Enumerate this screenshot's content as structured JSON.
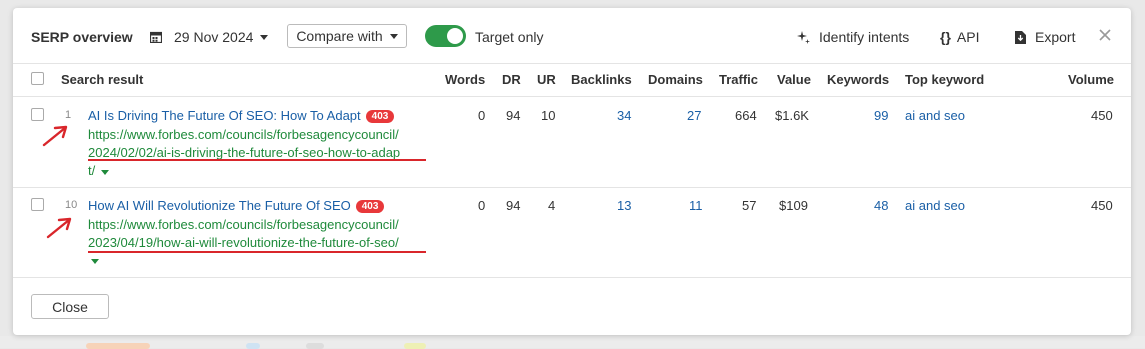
{
  "toolbar": {
    "title": "SERP overview",
    "date": "29 Nov 2024",
    "compare_label": "Compare with",
    "toggle_label": "Target only",
    "identify_intents": "Identify intents",
    "api": "API",
    "export": "Export"
  },
  "table": {
    "headers": {
      "search_result": "Search result",
      "words": "Words",
      "dr": "DR",
      "ur": "UR",
      "backlinks": "Backlinks",
      "domains": "Domains",
      "traffic": "Traffic",
      "value": "Value",
      "keywords": "Keywords",
      "top_keyword": "Top keyword",
      "volume": "Volume"
    },
    "rows": [
      {
        "position": "1",
        "title": "AI Is Driving The Future Of SEO: How To Adapt",
        "badge": "403",
        "url_lines": [
          "https://www.forbes.com/councils/forbesagencycouncil/",
          "2024/02/02/ai-is-driving-the-future-of-seo-how-to-adap",
          "t/"
        ],
        "words": "0",
        "dr": "94",
        "ur": "10",
        "backlinks": "34",
        "domains": "27",
        "traffic": "664",
        "value": "$1.6K",
        "keywords": "99",
        "top_keyword": "ai and seo",
        "volume": "450"
      },
      {
        "position": "10",
        "title": "How AI Will Revolutionize The Future Of SEO",
        "badge": "403",
        "url_lines": [
          "https://www.forbes.com/councils/forbesagencycouncil/",
          "2023/04/19/how-ai-will-revolutionize-the-future-of-seo/"
        ],
        "words": "0",
        "dr": "94",
        "ur": "4",
        "backlinks": "13",
        "domains": "11",
        "traffic": "57",
        "value": "$109",
        "keywords": "48",
        "top_keyword": "ai and seo",
        "volume": "450"
      }
    ]
  },
  "footer": {
    "close_label": "Close"
  },
  "colors": {
    "toggle_on": "#2e9a4a",
    "link": "#1a5fa6",
    "url": "#1f8a3b",
    "badge": "#e8383a",
    "annotation": "#d9262b"
  }
}
